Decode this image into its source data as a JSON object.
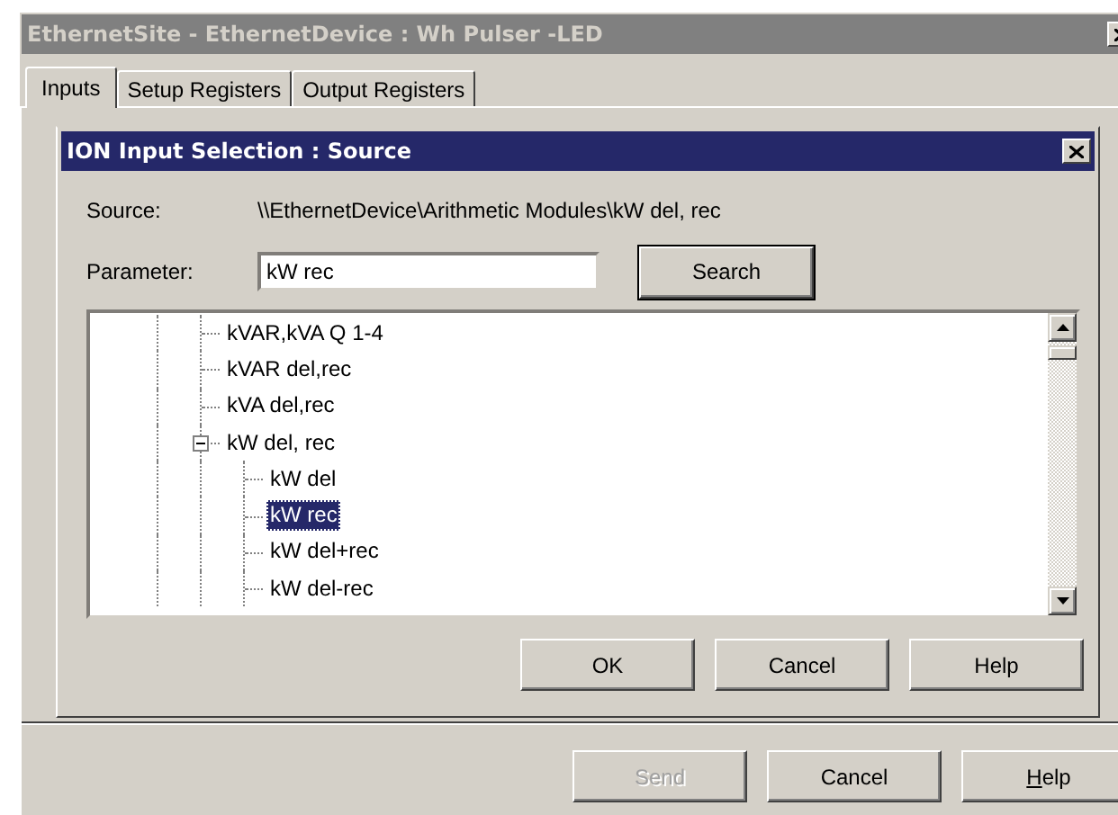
{
  "window": {
    "title": "EthernetSite - EthernetDevice : Wh Pulser -LED",
    "active": false
  },
  "tabs": [
    {
      "label": "Inputs",
      "selected": true
    },
    {
      "label": "Setup Registers",
      "selected": false
    },
    {
      "label": "Output Registers",
      "selected": false
    }
  ],
  "dialog": {
    "title": "ION Input Selection : Source",
    "active": true,
    "source_label": "Source:",
    "source_value": "\\\\EthernetDevice\\Arithmetic Modules\\kW del, rec",
    "parameter_label": "Parameter:",
    "parameter_value": "kW rec",
    "search_button": "Search",
    "tree": [
      {
        "label": "kVAR,kVA Q 1-4",
        "selected": false
      },
      {
        "label": "kVAR del,rec",
        "selected": false
      },
      {
        "label": "kVA del,rec",
        "selected": false
      },
      {
        "label": "kW del, rec",
        "selected": false,
        "expanded": true,
        "children": [
          {
            "label": "kW del",
            "selected": false
          },
          {
            "label": "kW rec",
            "selected": true
          },
          {
            "label": "kW del+rec",
            "selected": false
          },
          {
            "label": "kW del-rec",
            "selected": false
          }
        ]
      }
    ],
    "buttons": [
      {
        "label": "OK",
        "disabled": false
      },
      {
        "label": "Cancel",
        "disabled": false
      },
      {
        "label": "Help",
        "disabled": false
      }
    ]
  },
  "footer_buttons": [
    {
      "label": "Send",
      "disabled": true,
      "mnemonic_underlined": false
    },
    {
      "label": "Cancel",
      "disabled": false,
      "mnemonic_underlined": false
    },
    {
      "label": "Help",
      "disabled": false,
      "mnemonic_underlined": true
    }
  ]
}
